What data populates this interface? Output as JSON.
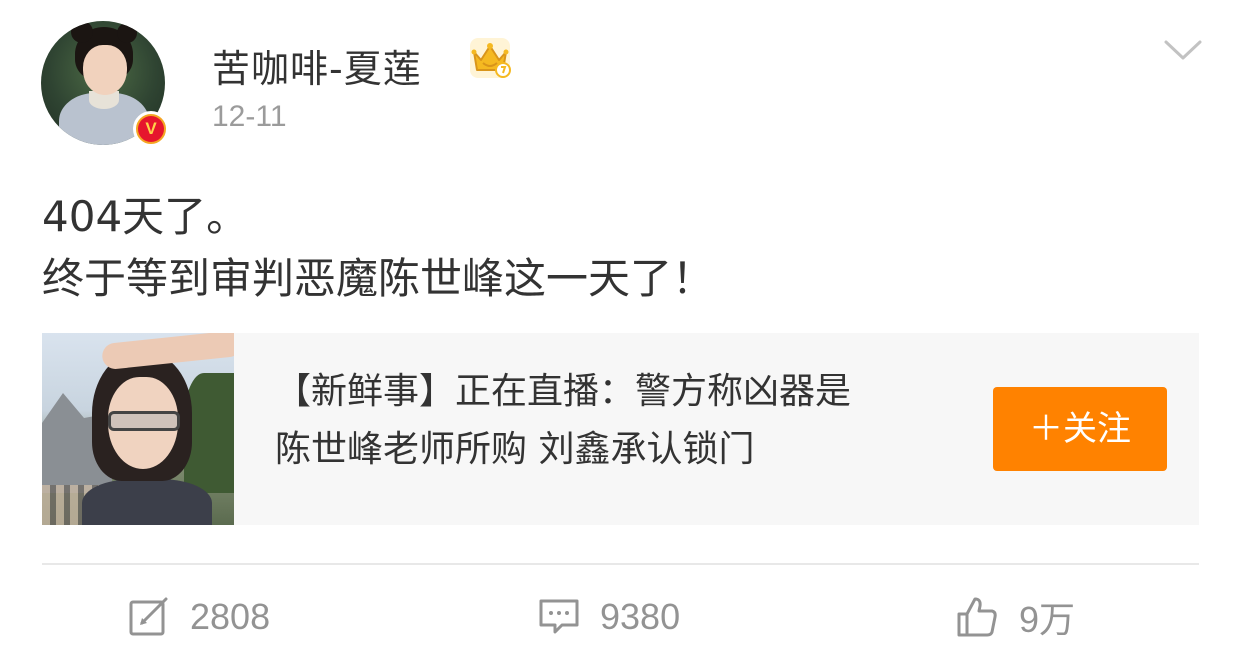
{
  "post": {
    "author": "苦咖啡-夏莲",
    "date": "12-11",
    "verified_badge": "V",
    "text_lines": [
      "404天了。",
      "终于等到审判恶魔陈世峰这一天了！"
    ]
  },
  "card": {
    "title_lines": [
      "【新鲜事】正在直播：警方称凶器是",
      "陈世峰老师所购 刘鑫承认锁门"
    ],
    "follow_label": "＋关注"
  },
  "actions": {
    "repost_count": "2808",
    "comment_count": "9380",
    "like_count": "9万"
  },
  "icons": {
    "badge": "crown-icon",
    "menu": "chevron-down-icon",
    "repost": "repost-icon",
    "comment": "comment-icon",
    "like": "thumbs-up-icon"
  },
  "colors": {
    "follow_button": "#ff8200",
    "muted_text": "#9b9b9b",
    "card_bg": "#f7f7f7",
    "verified_badge": "#e6162d",
    "crown": "#f5b921"
  }
}
